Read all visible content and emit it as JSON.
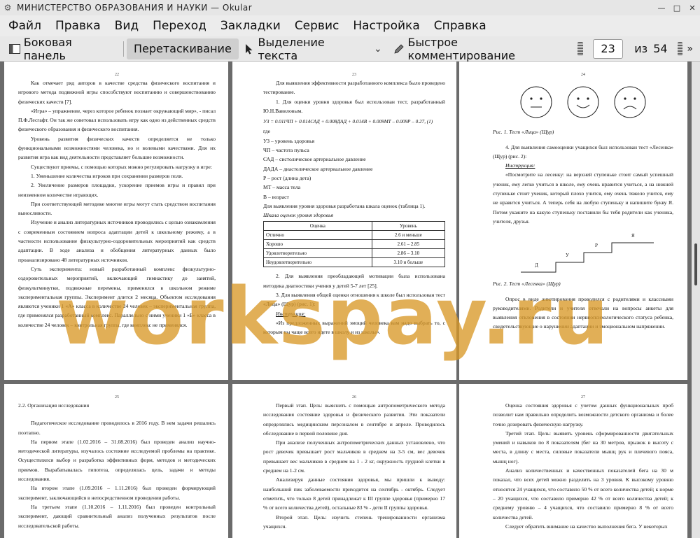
{
  "window": {
    "title": "МИНИСТЕРСТВО  ОБРАЗОВАНИЯ  И  НАУКИ   — Okular"
  },
  "menu": [
    "Файл",
    "Правка",
    "Вид",
    "Переход",
    "Закладки",
    "Сервис",
    "Настройка",
    "Справка"
  ],
  "toolbar": {
    "sidebar": "Боковая панель",
    "drag": "Перетаскивание",
    "select": "Выделение текста",
    "annotate": "Быстрое комментирование",
    "page_value": "23",
    "of": "из",
    "total": "54"
  },
  "watermark": "workspay.ru",
  "pages": {
    "p22": {
      "num": "22",
      "lines": [
        "Как отмечает ряд авторов  в качестве средства физического воспитания и игрового метода подвижной игры способствуют воспитанию и совершенствованию физических качеств [7].",
        "«Игра» – упражнение, через которое ребенок познает окружающий мир», - писал П.Ф.Лесгафт. Он так же советовал использовать игру как одно из действенных средств физического образования и физического воспитания.",
        "Уровень развития физических качеств определяется не только функциональными возможностями человека, но и волевыми качествами. Для их развития игра как вид деятельности представляет большие возможности.",
        "Существуют приемы, с помощью которых можно регулировать нагрузку в игре:"
      ],
      "list": [
        "1.   Уменьшение количества игроков при сохранении размеров поля.",
        "2.   Увеличение размеров площадки, ускорение приемов игры и правил при неизменном количестве играющих."
      ],
      "lines2": [
        "При соответствующей методике многие игры могут стать средством воспитания выносливости.",
        "Изучение и анализ литературных источников проводились с целью ознакомления с современным состоянием вопроса адаптации детей к школьному режиму, а в частности использование физкультурно-оздоровительных мероприятий как средств адаптации. В ходе анализа и обобщения литературных данных было проанализировано 48 литературных источников.",
        "Суть эксперимента: новый разработанный комплекс физкультурно-оздоровительных мероприятий, включающий гимнастику до занятий, физкультминутки, подвижные перемены, применялся в школьном режиме экспериментальная группы. Эксперимент длится 2 месяца. Объектом исследования являются ученики 1 «А» класса в количестве 24 человек – экспериментальная группа, где применялся разработанный комплекс. Параллельно с ними ученики 1 «Б» класса в количестве 24 человек – контрольная группа, где комплекс не применялся."
      ]
    },
    "p23": {
      "num": "23",
      "intro": "Для выявления эффективности разработанного комплекса было проведено тестирование.",
      "item1": "1. Для оценки уровня здоровья был использован тест, разработанный Ю.Н.Вавиловым.",
      "formula": "УЗ = 0.011ЧП + 0.014САД + 0.008ДАД + 0.014В + 0.009МТ – 0.009Р – 0.27,  (1)",
      "where": "где",
      "defs": [
        "УЗ – уровень здоровья",
        "ЧП – частота пульса",
        "САД – систолическое артериальное давление",
        "ДАДА – диастолическое артериальное давление",
        "Р – рост (длина дета)",
        "МТ – масса тела",
        "В – возраст"
      ],
      "scale_text": "Для выявления уровня здоровья разработана шкала оценок (таблица 1).",
      "table_caption": "Шкала оценок уровня здоровья",
      "table_head": [
        "Оценка",
        "Уровень"
      ],
      "table_rows": [
        [
          "Отлично",
          "2.6 и меньше"
        ],
        [
          "Хорошо",
          "2.61 – 2.85"
        ],
        [
          "Удовлетворительно",
          "2.86 – 3.10"
        ],
        [
          "Неудовлетворительно",
          "3.10 и больше"
        ]
      ],
      "item2": "2. Для выявления преобладающей мотивации была использована методика диагностики учения у детей 5-7 лет [25].",
      "item3": "3. Для выявления общей оценки отношения к школе был использован тест «Лица» (Щур) (рис. 1):",
      "instr": "Инструкция:",
      "quote": "«Из предложенных выражений эмоций человека вам надо выбрать то, с которым вы чаще всего идете в школу и из школы»."
    },
    "p24": {
      "num": "24",
      "fig1": "Рис. 1. Тест «Лица» (Щур)",
      "item4": "4. Для выявления самооценки учащихся был использован тест «Лесенка» (Щур) (рис. 2):",
      "instr": "Инструкция:",
      "quote": "«Посмотрите на лесенку: на верхней ступеньке стоит самый успешный ученик, ему легко учиться в школе, ему очень нравится учиться, а на нижней ступеньке стоит ученик, который плохо учится, ему очень тяжело учится, ему не нравится учиться. А теперь себя на любую ступеньку и напишите букву Я. Потом укажите на какую ступеньку поставили бы тебя родители как ученика, учителя, друзья.",
      "stairs": [
        "Д",
        "У",
        "Р",
        "Я"
      ],
      "fig2": "Рис. 2. Тест «Лесенка» (Щур)",
      "para": "Опрос в виде анкетирования проводился с родителями и классными руководителями. Родители и учителя отвечали на вопросы анкеты для выявления отклонения в состоянии нервнопсихологического статуса ребенка, свидетельствующие о нарушении адаптации и эмоциональном напряжении."
    },
    "p25": {
      "num": "25",
      "heading": "2.2. Организация исследования",
      "lines": [
        "Педагогическое исследование проводилось в 2016 году. В нем задачи решались поэтапно.",
        "На первом этапе (1.02.2016 – 31.08.2016) был проведен анализ научно-методической литературы, изучалось состояние исследуемой проблемы на практике. Осуществлялся выбор и разработка эффективных форм, методов и методических приемов. Вырабатывалась гипотеза, определялась цель, задачи и методы исследования.",
        "На втором этапе (1.09.2016 – 1.11.2016) был проведен формирующий эксперимент, заключающийся в непосредственном проведении работы.",
        "На третьем этапе (1.10.2016 – 1.11.2016) был проведен контрольный эксперимент, дающий сравнительный анализ полученных результатов после исследовательской работы."
      ]
    },
    "p26": {
      "num": "26",
      "lines": [
        "Первый этап. Цель: выяснить с помощью антропометрического метода исследования состояние здоровья и физического развития. Эти показатели определялись медицинским персоналом в сентябре и апреле. Проводилось обследование в первой половине дня.",
        "При анализе полученных антропометрических данных установлено, что рост девочек превышает рост мальчиков в среднем на 3-5 см, вес девочек превышает вес мальчиков в среднем на 1 - 2 кг, окружность грудной клетки в среднем на 1-2 см.",
        "Анализируя данные состояния здоровья, мы пришли к выводу: наибольший пик заболеваемости приходится на сентябрь - октябрь. Следует отметить, что только 8 детей  принадлежат к III группе здоровья (примерно 17 % от всего количества детей), остальные 83 % - дети II группы здоровья.",
        "Второй этап. Цель: изучить степень тренированности организма учащихся."
      ]
    },
    "p27": {
      "num": "27",
      "lines": [
        "Оценка состояния здоровья с учетом данных функциональных проб позволит нам правильно определить возможности детского организма и более точно дозировать физическую нагрузку.",
        "Третий этап. Цель: выявить уровень сформированности двигательных умений и навыков по 8 показателям (бег на 30 метров, прыжок в высоту с места, в длину с места, силовые показатели мышц рук и плечевого пояса, мышц ног).",
        "Анализ количественных и качественных показателей бега на 30 м показал, что всех детей можно разделить на 3 уровня. К высокому уровню относятся 24 учащихся, что составило 50 % от всего количества детей; к норме – 20 учащихся, что составило примерно 42 % от всего количества детей; к среднему уровню – 4 учащихся, что составило примерно 8 % от всего количества детей.",
        "Следует обратить внимание на качество выполнения бега. У некоторых"
      ]
    }
  }
}
